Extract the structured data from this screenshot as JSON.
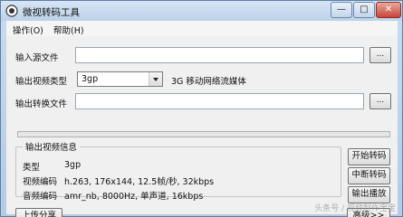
{
  "window": {
    "title": "微视转码工具",
    "min": "—",
    "max": "□",
    "close": "✕",
    "icon": "record-icon"
  },
  "menu": {
    "operate": "操作(O)",
    "help": "帮助(H)"
  },
  "input_file": {
    "label": "输入源文件",
    "value": "",
    "browse": "..."
  },
  "output_type": {
    "label": "输出视频类型",
    "selected": "3gp",
    "description": "3G 移动网络流媒体"
  },
  "output_file": {
    "label": "输出转换文件",
    "value": "",
    "browse": "..."
  },
  "progress": {
    "value": 0
  },
  "info": {
    "title": "输出视频信息",
    "type_label": "类型",
    "type_value": "3gp",
    "video_label": "视频编码",
    "video_value": "h.263, 176x144, 12.5帧/秒, 32kbps",
    "audio_label": "音频编码",
    "audio_value": "amr_nb, 8000Hz, 单声道, 16kbps"
  },
  "buttons": {
    "start": "开始转码",
    "stop": "中断转码",
    "play": "输出播放",
    "share": "上传分享",
    "advanced": "高级>>"
  },
  "watermark": "头条号 / 视频制作宝宝"
}
